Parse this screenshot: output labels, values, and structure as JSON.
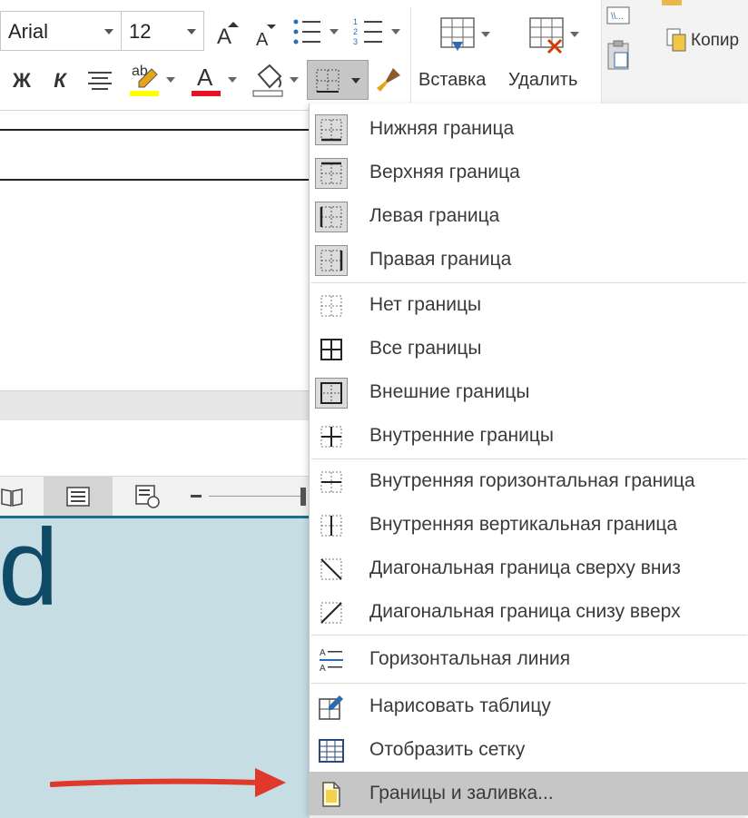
{
  "ribbon": {
    "font_name": "Arial",
    "font_size": "12",
    "bold_label": "Ж",
    "italic_label": "К",
    "insert_label": "Вставка",
    "delete_label": "Удалить",
    "copy_label": "Копир",
    "highlight_text": "ab",
    "font_color_text": "A",
    "highlight_color": "#ffff00",
    "font_color": "#e81123"
  },
  "menu": {
    "items": [
      {
        "label": "Нижняя граница",
        "icon": "bottom-border-icon"
      },
      {
        "label": "Верхняя граница",
        "icon": "top-border-icon"
      },
      {
        "label": "Левая граница",
        "icon": "left-border-icon"
      },
      {
        "label": "Правая граница",
        "icon": "right-border-icon"
      },
      {
        "label": "Нет границы",
        "icon": "no-border-icon"
      },
      {
        "label": "Все границы",
        "icon": "all-borders-icon"
      },
      {
        "label": "Внешние границы",
        "icon": "outside-borders-icon"
      },
      {
        "label": "Внутренние границы",
        "icon": "inside-borders-icon"
      },
      {
        "label": "Внутренняя горизонтальная граница",
        "icon": "inside-horizontal-border-icon"
      },
      {
        "label": "Внутренняя вертикальная граница",
        "icon": "inside-vertical-border-icon"
      },
      {
        "label": "Диагональная граница сверху вниз",
        "icon": "diagonal-down-border-icon"
      },
      {
        "label": "Диагональная граница снизу вверх",
        "icon": "diagonal-up-border-icon"
      },
      {
        "label": "Горизонтальная линия",
        "icon": "horizontal-line-icon"
      },
      {
        "label": "Нарисовать таблицу",
        "icon": "draw-table-icon"
      },
      {
        "label": "Отобразить сетку",
        "icon": "view-gridlines-icon"
      },
      {
        "label": "Границы и заливка...",
        "icon": "borders-and-shading-icon"
      }
    ]
  },
  "slide": {
    "big_letter": "d"
  },
  "colors": {
    "accent": "#1e6e8a",
    "slide_bg": "#c7dde4",
    "arrow": "#e0392b",
    "menu_highlight": "#c6c6c6"
  }
}
